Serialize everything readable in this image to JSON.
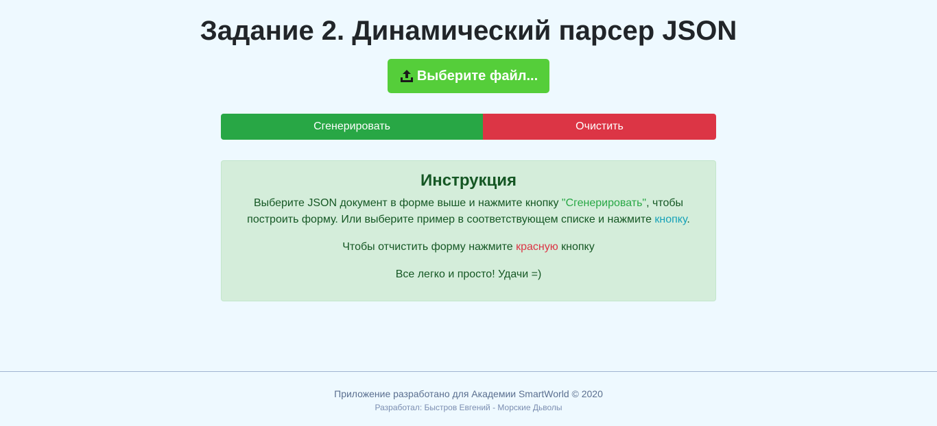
{
  "page": {
    "title": "Задание 2. Динамический парсер JSON"
  },
  "upload": {
    "label": "Выберите файл...",
    "icon": "upload-icon",
    "color": "#55ce3a"
  },
  "actions": {
    "generate_label": "Сгенерировать",
    "generate_color": "#28a745",
    "clear_label": "Очистить",
    "clear_color": "#dc3545"
  },
  "instruction": {
    "heading": "Инструкция",
    "p1_part1": "Выберите JSON документ в форме выше и нажмите кнопку ",
    "p1_highlight1": "\"Сгенерировать\"",
    "p1_part2": ", чтобы построить форму. Или выберите пример в соответствующем списке и нажмите ",
    "p1_link": "кнопку",
    "p1_end": ".",
    "p2_part1": "Чтобы отчистить форму нажмите ",
    "p2_highlight": "красную",
    "p2_part2": " кнопку",
    "p3": "Все легко и просто! Удачи =)"
  },
  "footer": {
    "main": "Приложение разработано для Академии SmartWorld © 2020",
    "sub": "Разработал: Быстров Евгений - Морские Дьволы"
  }
}
